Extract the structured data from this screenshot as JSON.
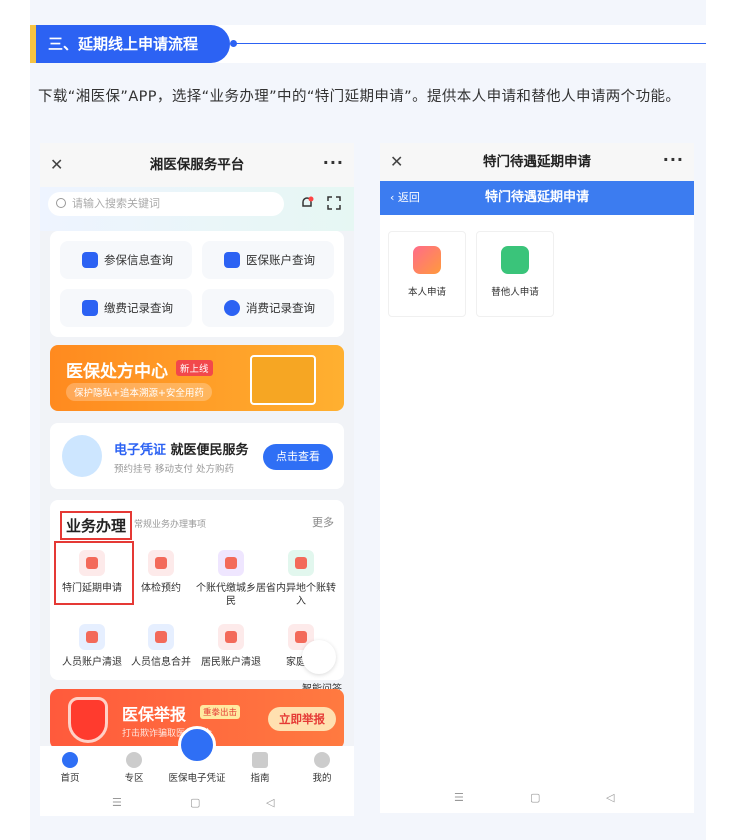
{
  "section": {
    "title": "三、延期线上申请流程"
  },
  "intro": "下载“湘医保”APP，选择“业务办理”中的“特门延期申请”。提供本人申请和替他人申请两个功能。",
  "phone1": {
    "title": "湘医保服务平台",
    "close": "✕",
    "more": "···",
    "search_placeholder": "请输入搜索关键词",
    "quick": [
      "参保信息查询",
      "医保账户查询",
      "缴费记录查询",
      "消费记录查询"
    ],
    "banner": {
      "title": "医保处方中心",
      "tag": "新上线",
      "sub": "保护隐私+追本溯源+安全用药"
    },
    "evoucher": {
      "title_blue": "电子凭证",
      "title_black": " 就医便民服务",
      "sub": "预约挂号  移动支付  处方购药",
      "button": "点击查看"
    },
    "biz": {
      "title": "业务办理",
      "sub": "常规业务办理事项",
      "more": "更多",
      "items": [
        "特门延期申请",
        "体检预约",
        "个账代缴城乡居民",
        "省内异地个账转入",
        "人员账户清退",
        "人员信息合并",
        "居民账户清退",
        "家庭共"
      ]
    },
    "ai_label": "智能问答",
    "report": {
      "title": "医保举报",
      "tag": "重拳出击",
      "sub": "打击欺诈骗取医保基金",
      "button": "立即举报"
    },
    "tabs": [
      "首页",
      "专区",
      "医保电子凭证",
      "指南",
      "我的"
    ],
    "nav": [
      "☰",
      "▢",
      "◁"
    ]
  },
  "phone2": {
    "title": "特门待遇延期申请",
    "close": "✕",
    "more": "···",
    "header": "特门待遇延期申请",
    "back": "‹ 返回",
    "options": [
      "本人申请",
      "替他人申请"
    ],
    "nav": [
      "☰",
      "▢",
      "◁"
    ]
  }
}
